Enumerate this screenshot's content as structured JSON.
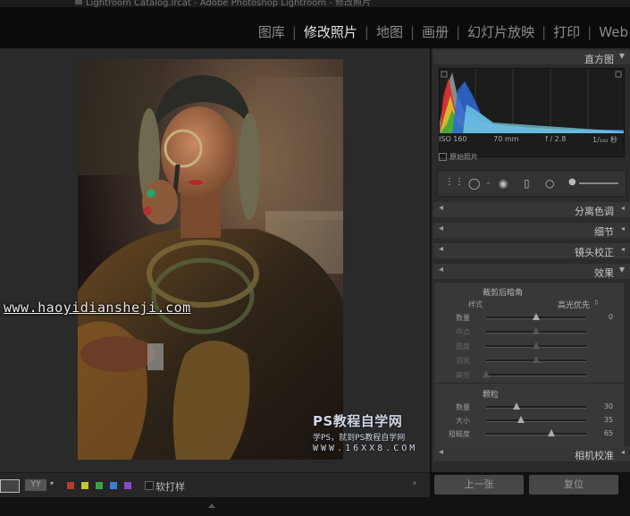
{
  "window": {
    "title": "Lightroom Catalog.lrcat - Adobe Photoshop Lightroom - 修改照片"
  },
  "modules": [
    {
      "label": "图库"
    },
    {
      "label": "修改照片"
    },
    {
      "label": "地图"
    },
    {
      "label": "画册"
    },
    {
      "label": "幻灯片放映"
    },
    {
      "label": "打印"
    },
    {
      "label": "Web"
    }
  ],
  "active_module": "修改照片",
  "histogram": {
    "title": "直方图",
    "iso": "ISO 160",
    "focal": "70 mm",
    "aperture": "f / 2.8",
    "shutter": "1/₁₆₀ 秒",
    "original_label": "原始照片"
  },
  "panels": {
    "split_toning": "分离色调",
    "detail": "细节",
    "lens": "镜头校正",
    "effects": "效果",
    "camera": "相机校准"
  },
  "vignette": {
    "title": "裁剪后暗角",
    "style_label": "样式",
    "style_value": "高光优先",
    "rows": [
      {
        "label": "数量",
        "value": "0",
        "pos": 0.5
      },
      {
        "label": "中点",
        "value": "",
        "pos": 0.5
      },
      {
        "label": "圆度",
        "value": "",
        "pos": 0.5
      },
      {
        "label": "羽化",
        "value": "",
        "pos": 0.5
      },
      {
        "label": "高光",
        "value": "",
        "pos": 0.0
      }
    ]
  },
  "grain": {
    "title": "颗粒",
    "rows": [
      {
        "label": "数量",
        "value": "30",
        "pos": 0.3
      },
      {
        "label": "大小",
        "value": "35",
        "pos": 0.35
      },
      {
        "label": "粗糙度",
        "value": "65",
        "pos": 0.65
      }
    ]
  },
  "buttons": {
    "previous": "上一张",
    "reset": "复位"
  },
  "bottom_toolbar": {
    "soft_proof": "软打样",
    "compare_label": "YY"
  },
  "color_labels": [
    "#c0392b",
    "#c9c22e",
    "#3aa048",
    "#3d7fd1",
    "#8a4bc8"
  ],
  "watermarks": {
    "site": "www.haoyidiansheji.com",
    "ps_title": "PS教程自学网",
    "ps_sub": "学PS，就到PS教程自学网",
    "ps_url": "WWW.16XX8.COM"
  }
}
